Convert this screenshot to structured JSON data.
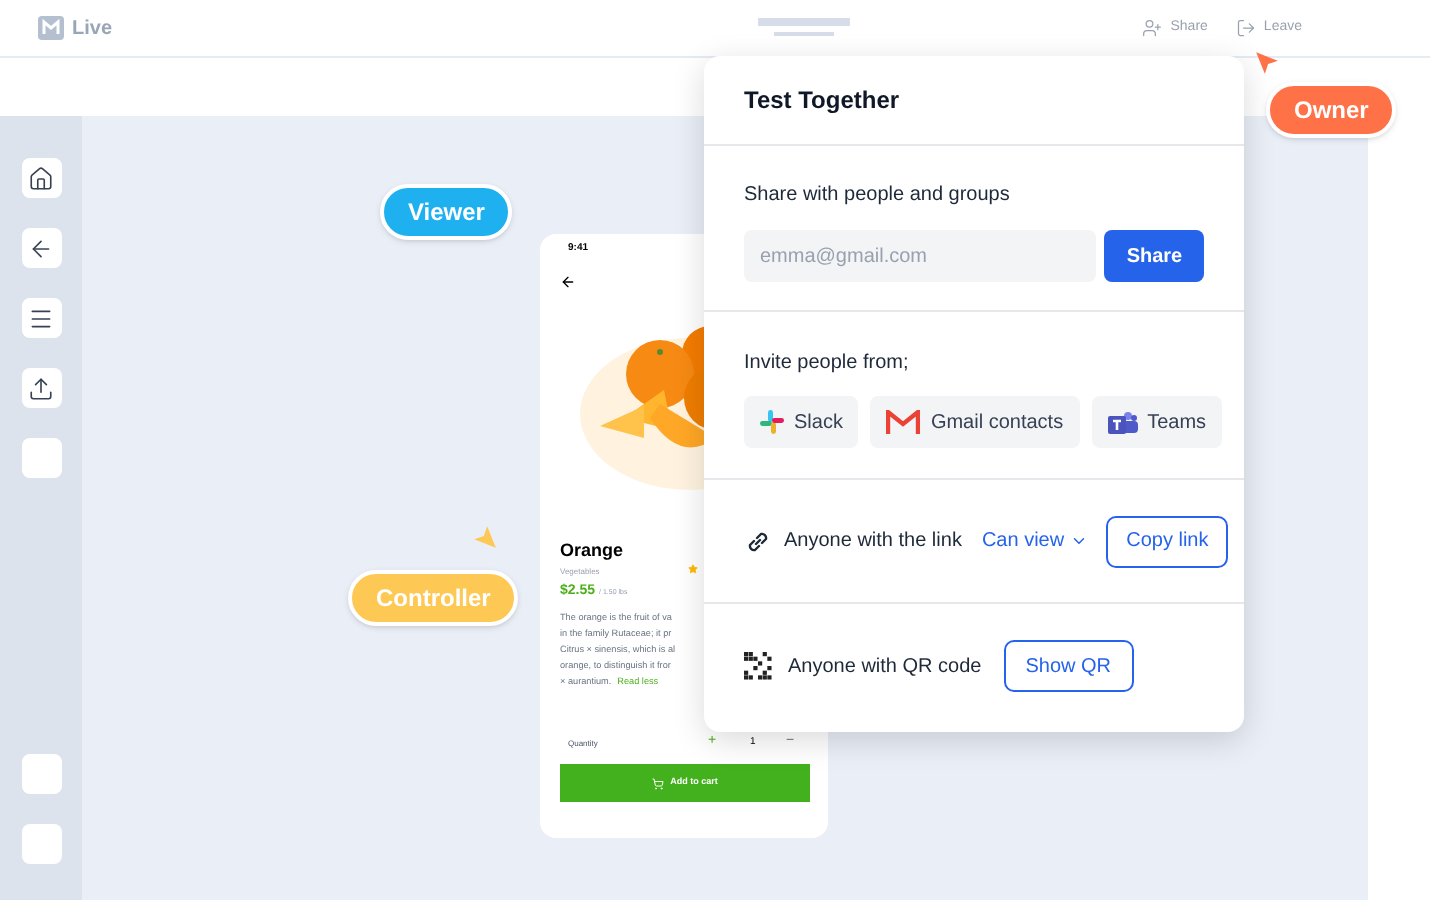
{
  "app": {
    "name": "Live"
  },
  "top_actions": [
    {
      "kind": "share",
      "label": "Share"
    },
    {
      "kind": "leave",
      "label": "Leave"
    }
  ],
  "sidebar": {
    "items": [
      {
        "kind": "home"
      },
      {
        "kind": "back"
      },
      {
        "kind": "menu"
      },
      {
        "kind": "upload"
      },
      {
        "kind": "blank"
      }
    ],
    "bottom_items": [
      {
        "kind": "blank"
      },
      {
        "kind": "blank"
      }
    ]
  },
  "role_tags": [
    {
      "label": "Viewer",
      "color": "#1fb0ef"
    },
    {
      "label": "Controller",
      "color": "#fdc853"
    },
    {
      "label": "Owner",
      "color": "#ff7147"
    }
  ],
  "phone": {
    "time": "9:41",
    "title": "Orange",
    "category": "Vegetables",
    "price": "$2.55",
    "unit": "/ 1.50 lbs",
    "description": [
      "The orange is the fruit of va",
      "in the family Rutaceae; it pr",
      "Citrus × sinensis, which is al",
      "orange, to distinguish it fror"
    ],
    "description_end": "× aurantium.",
    "read_less": "Read less",
    "quantity_label": "Quantity",
    "plus": "+",
    "quantity": "1",
    "minus": "−",
    "add_to_cart": "Add to cart"
  },
  "dialog": {
    "title": "Test Together",
    "share_heading": "Share with people and groups",
    "email_placeholder": "emma@gmail.com",
    "share_button": "Share",
    "invite_heading": "Invite people from;",
    "invite_sources": [
      {
        "kind": "slack",
        "label": "Slack"
      },
      {
        "kind": "gmail",
        "label": "Gmail contacts"
      },
      {
        "kind": "teams",
        "label": "Teams"
      }
    ],
    "link_row": {
      "label": "Anyone with the link",
      "permission": "Can view",
      "button": "Copy link"
    },
    "qr_row": {
      "label": "Anyone with QR code",
      "button": "Show QR"
    }
  }
}
